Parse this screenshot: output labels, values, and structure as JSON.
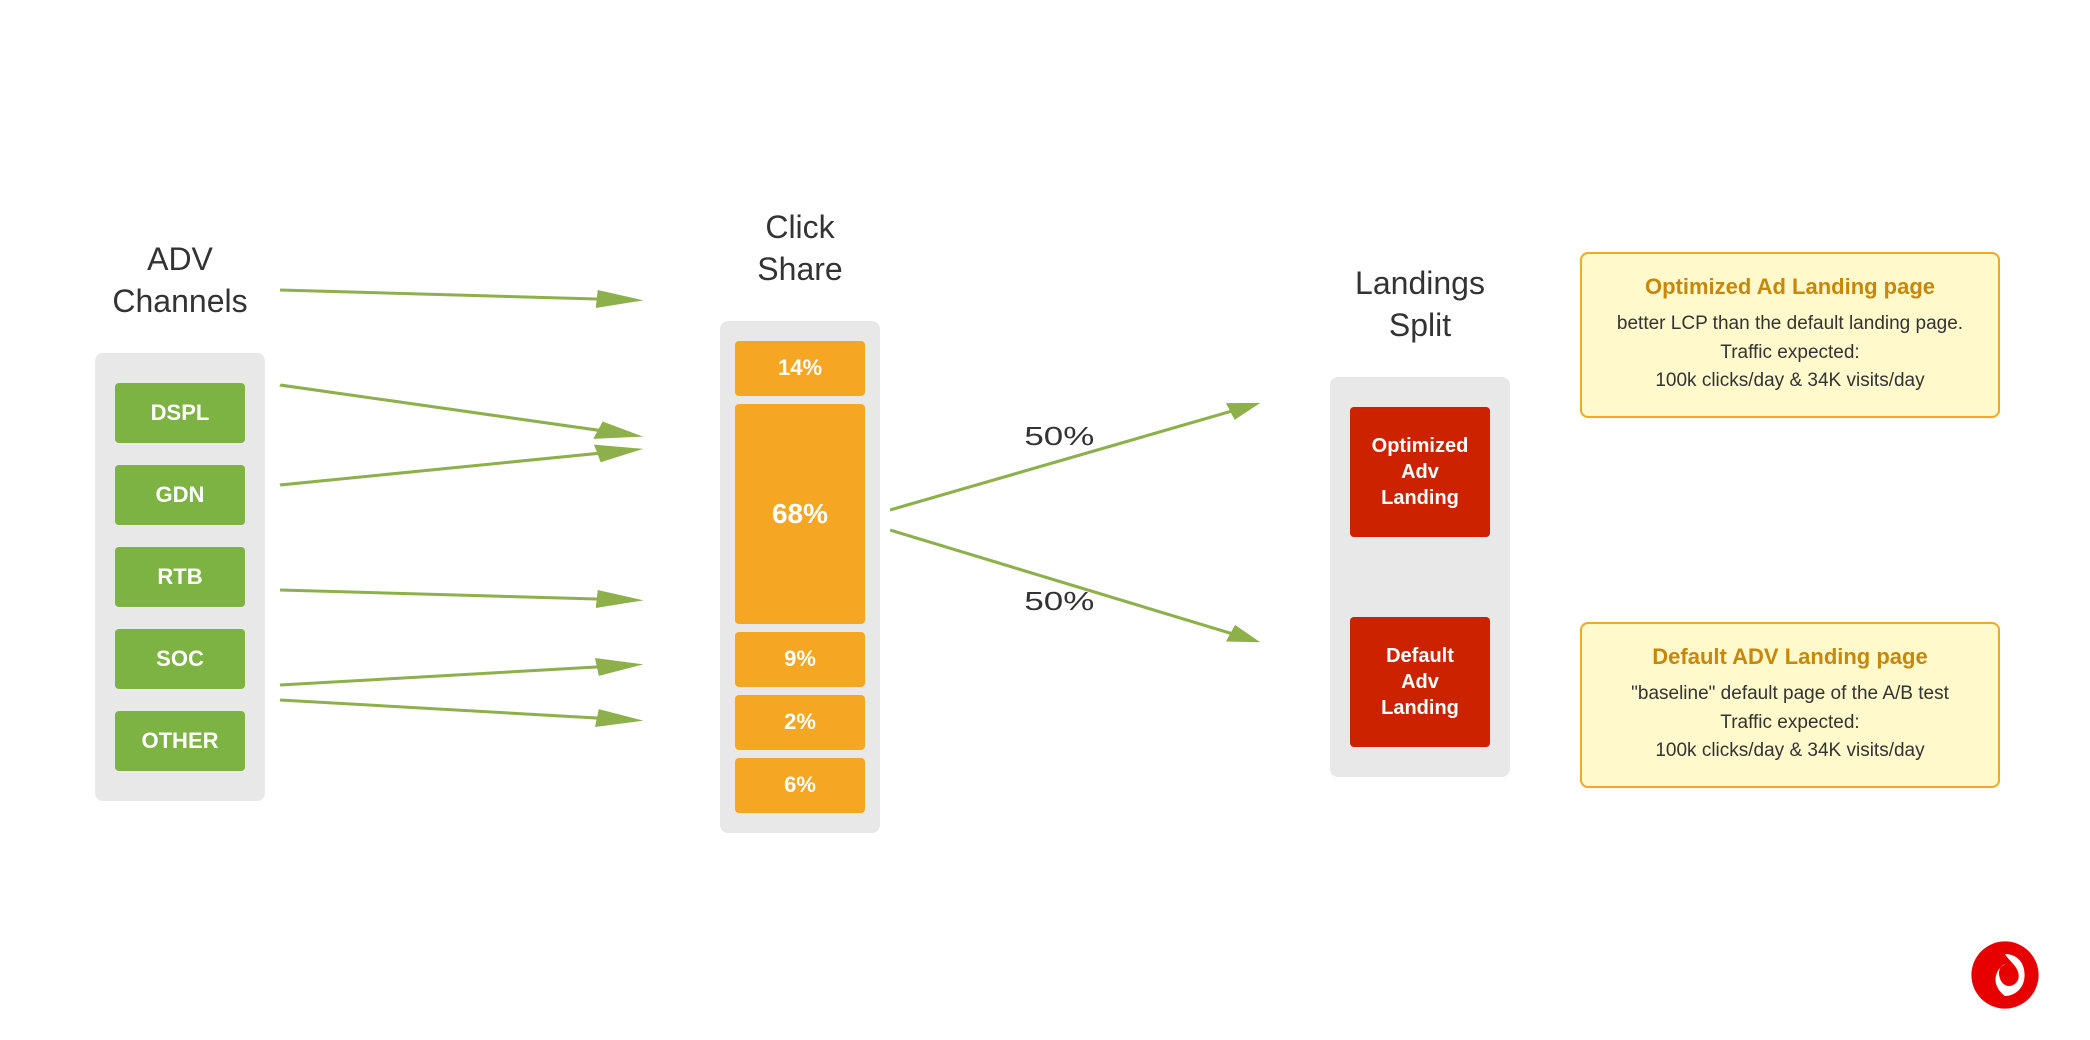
{
  "headers": {
    "adv_channels": "ADV\nChannels",
    "click_share": "Click\nShare",
    "landings_split": "Landings\nSplit"
  },
  "channels": [
    {
      "label": "DSPL"
    },
    {
      "label": "GDN"
    },
    {
      "label": "RTB"
    },
    {
      "label": "SOC"
    },
    {
      "label": "OTHER"
    }
  ],
  "click_shares": [
    {
      "value": "14%",
      "size": "small"
    },
    {
      "value": "68%",
      "size": "large"
    },
    {
      "value": "9%",
      "size": "small"
    },
    {
      "value": "2%",
      "size": "small"
    },
    {
      "value": "6%",
      "size": "small"
    }
  ],
  "landings": [
    {
      "label": "Optimized\nAdv\nLanding"
    },
    {
      "label": "Default\nAdv\nLanding"
    }
  ],
  "split_percentages": [
    {
      "value": "50%"
    },
    {
      "value": "50%"
    }
  ],
  "info_cards": [
    {
      "title": "Optimized Ad Landing page",
      "text": "better LCP than the default landing page.\nTraffic expected:\n100k clicks/day  & 34K visits/day"
    },
    {
      "title": "Default ADV Landing page",
      "text": "\"baseline\" default page of the A/B test\nTraffic expected:\n100k clicks/day  & 34K visits/day"
    }
  ],
  "colors": {
    "channel_green": "#7cb342",
    "share_orange": "#f5a623",
    "landing_red": "#cc2200",
    "card_border": "#f5a623",
    "card_bg": "#fff9cc",
    "card_title": "#c8860a",
    "arrow_green": "#8db04b",
    "panel_bg": "#e8e8e8",
    "vodafone_red": "#e60000"
  }
}
